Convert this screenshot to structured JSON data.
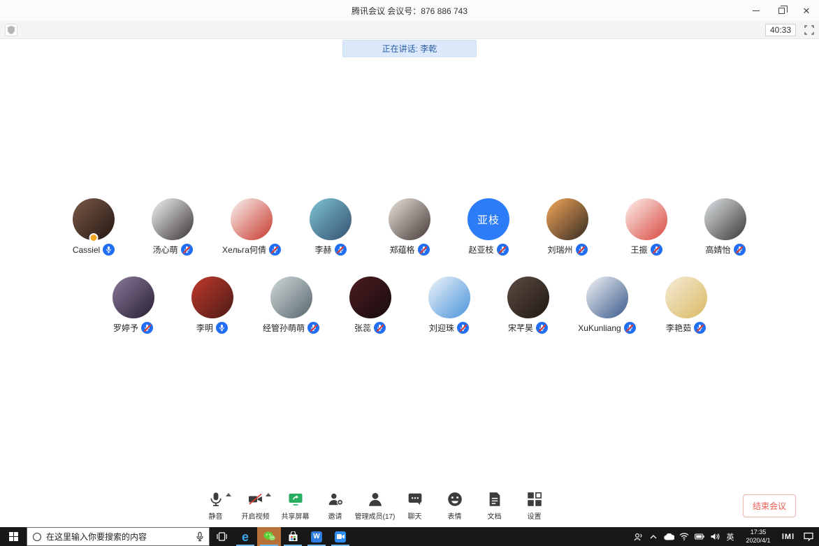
{
  "window": {
    "title": "腾讯会议 会议号：876 886 743",
    "close_glyph": "✕"
  },
  "meeting_bar": {
    "duration": "40:33"
  },
  "speaking_banner": "正在讲话: 李乾",
  "participants_row1": [
    {
      "name": "Cassiel",
      "mic": "active",
      "badge": true,
      "avatar": {
        "type": "photo",
        "colors": [
          "#7a5a48",
          "#241612"
        ]
      }
    },
    {
      "name": "汤心萌",
      "mic": "muted",
      "badge": false,
      "avatar": {
        "type": "photo",
        "colors": [
          "#f5f5f5",
          "#3a3434"
        ]
      }
    },
    {
      "name": "Xeльгa何倩",
      "mic": "muted",
      "badge": false,
      "avatar": {
        "type": "photo",
        "colors": [
          "#faf5f3",
          "#c8372b"
        ]
      }
    },
    {
      "name": "李赫",
      "mic": "muted",
      "badge": false,
      "avatar": {
        "type": "photo",
        "colors": [
          "#7ec4d6",
          "#34506e"
        ]
      }
    },
    {
      "name": "郑蕴格",
      "mic": "muted",
      "badge": false,
      "avatar": {
        "type": "photo",
        "colors": [
          "#e9e3dd",
          "#463a36"
        ]
      }
    },
    {
      "name": "赵亚枝",
      "mic": "muted",
      "badge": false,
      "avatar": {
        "type": "text",
        "text": "亚枝",
        "bg": "#2b7cf6"
      }
    },
    {
      "name": "刘瑞州",
      "mic": "muted",
      "badge": false,
      "avatar": {
        "type": "photo",
        "colors": [
          "#f2a85a",
          "#342a22"
        ]
      }
    },
    {
      "name": "王振",
      "mic": "muted",
      "badge": false,
      "avatar": {
        "type": "photo",
        "colors": [
          "#fdf2ef",
          "#d8473d"
        ]
      }
    },
    {
      "name": "高婧怡",
      "mic": "muted",
      "badge": false,
      "avatar": {
        "type": "photo",
        "colors": [
          "#e0e4e7",
          "#3a3836"
        ]
      }
    }
  ],
  "participants_row2": [
    {
      "name": "罗婷予",
      "mic": "muted",
      "badge": false,
      "avatar": {
        "type": "photo",
        "colors": [
          "#8a7a9a",
          "#281f34"
        ]
      }
    },
    {
      "name": "李明",
      "mic": "active",
      "badge": false,
      "avatar": {
        "type": "photo",
        "colors": [
          "#c23a2c",
          "#4a1a16"
        ]
      }
    },
    {
      "name": "经管孙萌萌",
      "mic": "muted",
      "badge": false,
      "avatar": {
        "type": "photo",
        "colors": [
          "#d2dada",
          "#56666e"
        ]
      }
    },
    {
      "name": "张蕊",
      "mic": "muted",
      "badge": false,
      "avatar": {
        "type": "photo",
        "colors": [
          "#4c1d22",
          "#170b0d"
        ]
      }
    },
    {
      "name": "刘迎珠",
      "mic": "muted",
      "badge": false,
      "avatar": {
        "type": "photo",
        "colors": [
          "#eef5f9",
          "#4a92da"
        ]
      }
    },
    {
      "name": "宋芊昊",
      "mic": "muted",
      "badge": false,
      "avatar": {
        "type": "photo",
        "colors": [
          "#5c4c42",
          "#201812"
        ]
      }
    },
    {
      "name": "XuKunliang",
      "mic": "muted",
      "badge": false,
      "avatar": {
        "type": "photo",
        "colors": [
          "#f3f5f7",
          "#38588a"
        ]
      }
    },
    {
      "name": "李艳茹",
      "mic": "muted",
      "badge": false,
      "avatar": {
        "type": "photo",
        "colors": [
          "#f6ecd8",
          "#d9ba62"
        ]
      }
    }
  ],
  "toolbar": {
    "items": [
      {
        "id": "mute",
        "label": "静音",
        "arrow": true
      },
      {
        "id": "video",
        "label": "开启视频",
        "arrow": true
      },
      {
        "id": "share",
        "label": "共享屏幕",
        "arrow": false
      },
      {
        "id": "invite",
        "label": "邀请",
        "arrow": false
      },
      {
        "id": "members",
        "label": "管理成员(17)",
        "arrow": false
      },
      {
        "id": "chat",
        "label": "聊天",
        "arrow": false
      },
      {
        "id": "emoji",
        "label": "表情",
        "arrow": false
      },
      {
        "id": "docs",
        "label": "文档",
        "arrow": false
      },
      {
        "id": "settings",
        "label": "设置",
        "arrow": false
      }
    ],
    "end_meeting": "结束会议"
  },
  "taskbar": {
    "search_placeholder": "在这里输入你要搜索的内容",
    "wps_label": "W",
    "ime": "英",
    "time": "17:35",
    "date": "2020/4/1",
    "m_badge": "lMl"
  },
  "colors": {
    "accent_blue": "#1f6ef5",
    "muted_slash_red": "#e23c30",
    "banner_bg": "#dbe9fb",
    "banner_text": "#2a5ca8",
    "end_button_red": "#e85d52",
    "share_green": "#27ae60",
    "taskbar_bg": "#181818",
    "wechat_highlight": "#b9713a"
  }
}
